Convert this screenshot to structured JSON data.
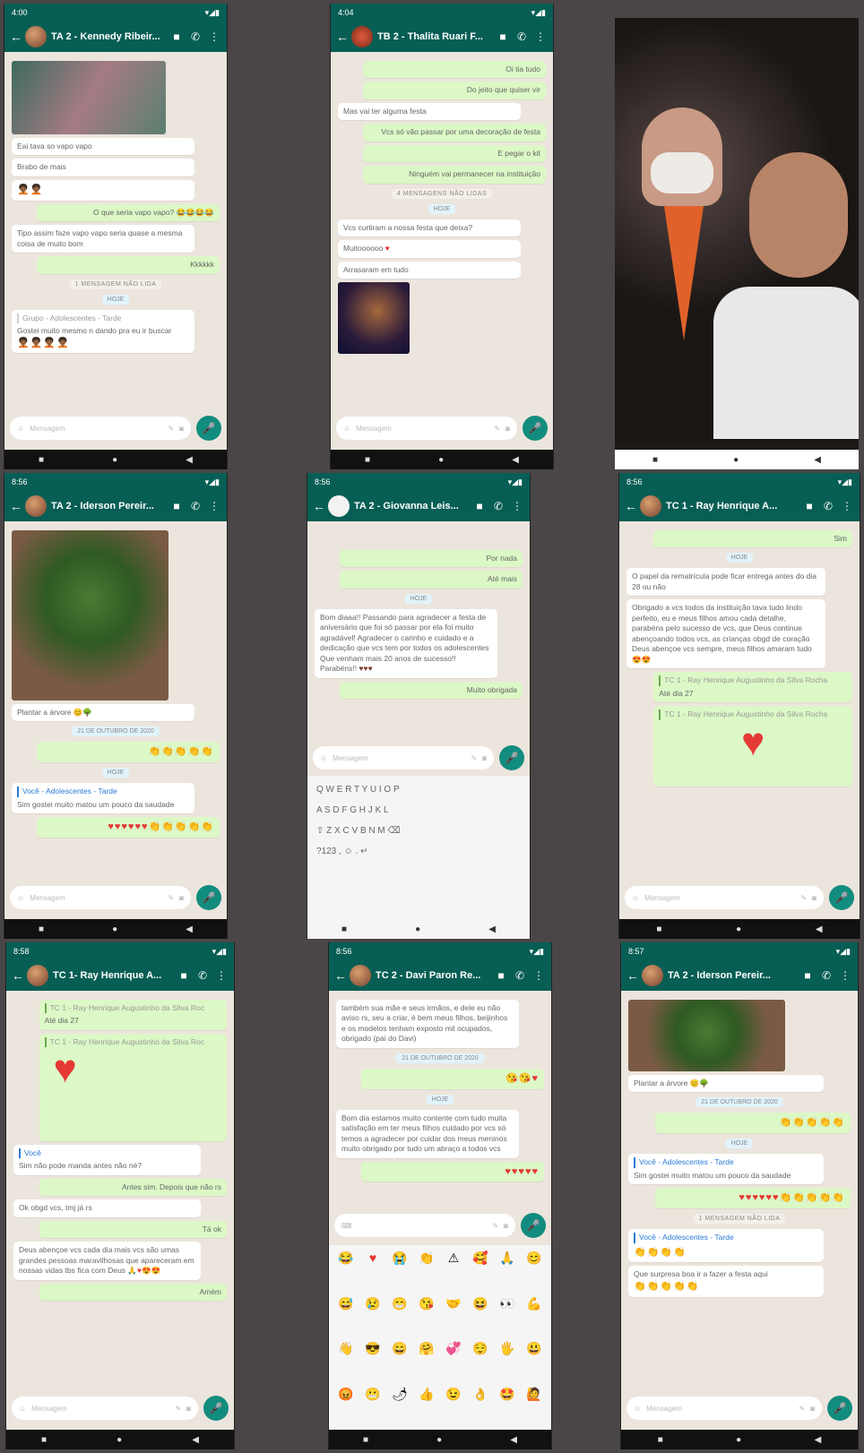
{
  "screens": {
    "s1": {
      "status_time": "4:00",
      "title": "TA 2 - Kennedy Ribeir...",
      "messages": [
        {
          "text": "Eai tava so vapo vapo"
        },
        {
          "text": "Brabo de mais"
        },
        {
          "text": "O que seria vapo vapo?"
        },
        {
          "text": "Tipo assim faze vapo vapo seria quase a mesma coisa de muito bom"
        },
        {
          "text": "Kkkkkk"
        },
        {
          "text": "1 MENSAGEM NÃO LIDA"
        },
        {
          "text": "HOJE"
        },
        {
          "text": "Grupo - Adolescentes - Tarde"
        },
        {
          "text": "Gostei muito mesmo n dando pra eu ir buscar"
        }
      ]
    },
    "s2": {
      "status_time": "4:04",
      "title": "TB 2 - Thalita Ruari F...",
      "messages": [
        {
          "text": "Oi tia tudo"
        },
        {
          "text": "Do jeito que quiser vir"
        },
        {
          "text": "Mas vai ter alguma festa"
        },
        {
          "text": "Vcs só vão passar por uma decoração de festa"
        },
        {
          "text": "E pegar o kit"
        },
        {
          "text": "Ninguém vai permanecer na instituição"
        },
        {
          "text": "4 MENSAGENS NÃO LIDAS"
        },
        {
          "text": "HOJE"
        },
        {
          "text": "Vcs curtiram a nossa festa que deixa?"
        },
        {
          "text": "Muitoooooo"
        },
        {
          "text": "Arrasaram em tudo"
        }
      ]
    },
    "s4": {
      "status_time": "8:56",
      "title": "TA 2 - Iderson Pereir...",
      "messages": [
        {
          "text": "Plantar a árvore"
        },
        {
          "text": "21 DE OUTUBRO DE 2020"
        },
        {
          "text": "HOJE"
        },
        {
          "text": "Você - Adolescentes - Tarde"
        },
        {
          "text": "Sim gostei muito matou um pouco da saudade"
        }
      ]
    },
    "s5": {
      "status_time": "8:56",
      "title": "TA 2 - Giovanna Leis...",
      "messages": [
        {
          "text": "Por nada"
        },
        {
          "text": "Até mais"
        },
        {
          "text": "HOJE"
        },
        {
          "text": "Bom diaaa!! Passando para agradecer a festa de aniversário que foi só passar por ela foi muito agradável! Agradecer o carinho e cuidado e a dedicação que vcs tem por todos os adolescentes Que venham mais 20 anos de sucesso!! Parabéns!!"
        },
        {
          "text": "Muito obrigada"
        }
      ],
      "keyboard_rows": [
        "Q W E R T Y U I O P",
        "A S D F G H J K L",
        "⇧ Z X C V B N M ⌫",
        "?123 , ☺ . ↵"
      ]
    },
    "s6": {
      "status_time": "8:56",
      "title": "TC 1 - Ray Henrique A...",
      "messages": [
        {
          "text": "Sim"
        },
        {
          "text": "HOJE"
        },
        {
          "text": "O papel da rematrícula pode ficar entrega antes do dia 28 ou não"
        },
        {
          "text": "Obrigado a vcs todos da instituição tava tudo lindo perfeito, eu e meus filhos amou cada detalhe, parabéns pelo sucesso de vcs, que Deus continue abençoando todos vcs, as crianças obgd de coração Deus abençoe vcs sempre, meus filhos amaram tudo"
        },
        {
          "text": "TC 1 - Ray Henrique Augustinho da Silva Rocha"
        },
        {
          "text": "Até dia 27"
        },
        {
          "text": "TC 1 - Ray Henrique Augustinho da Silva Rocha"
        }
      ]
    },
    "s7": {
      "status_time": "8:58",
      "title": "TC 1- Ray Henrique A...",
      "messages": [
        {
          "text": "TC 1 - Ray Henrique Augustinho da Silva Roc"
        },
        {
          "text": "Até dia 27"
        },
        {
          "text": "TC 1 - Ray Henrique Augustinho da Silva Roc"
        },
        {
          "text": "Você"
        },
        {
          "text": "Sim não pode manda antes não né?"
        },
        {
          "text": "Antes sim. Depois que não rs"
        },
        {
          "text": "Ok obgd vcs, tmj já rs"
        },
        {
          "text": "Tá ok"
        },
        {
          "text": "Deus abençoe vcs cada dia mais vcs são umas grandes pessoas maravilhosas que apareceram em nossas vidas tbs fica com Deus"
        },
        {
          "text": "Amém"
        }
      ]
    },
    "s8": {
      "status_time": "8:56",
      "title": "TC 2 - Davi Paron Re...",
      "messages": [
        {
          "text": "também sua mãe e seus irmãos, e dele eu não aviso rs, seu a criar, é bem meus filhos, beijinhos e os modelos tenham exposto mil ocupados, obrigado (pai do Davi)"
        },
        {
          "text": "21 DE OUTUBRO DE 2020"
        },
        {
          "text": "HOJE"
        },
        {
          "text": "Bom dia estamos muito contente com tudo muita satisfação em ter meus filhos cuidado por vcs só temos a agradecer por cuidar dos meus meninos muito obrigado por tudo um abraço a todos vcs"
        }
      ]
    },
    "s9": {
      "status_time": "8:57",
      "title": "TA 2 - Iderson Pereir...",
      "messages": [
        {
          "text": "Plantar a árvore"
        },
        {
          "text": "21 DE OUTUBRO DE 2020"
        },
        {
          "text": "HOJE"
        },
        {
          "text": "Você - Adolescentes - Tarde"
        },
        {
          "text": "Sim gostei muito matou um pouco da saudade"
        },
        {
          "text": "1 MENSAGEM NÃO LIDA"
        },
        {
          "text": "Você - Adolescentes - Tarde"
        },
        {
          "text": "Que surpresa boa ir a fazer a festa aqui"
        }
      ]
    }
  },
  "input_placeholder": "Mensagem",
  "icons": {
    "back": "arrow-left-icon",
    "video": "video-camera-icon",
    "call": "phone-icon",
    "menu": "more-vert-icon",
    "mic": "microphone-icon",
    "camera": "camera-icon",
    "attach": "paperclip-icon",
    "emoji": "smiley-icon"
  },
  "colors": {
    "header": "#075e54",
    "chat_bg": "#ece5dd",
    "outgoing": "#dcf8c6",
    "incoming": "#ffffff",
    "mic": "#128c7e"
  }
}
